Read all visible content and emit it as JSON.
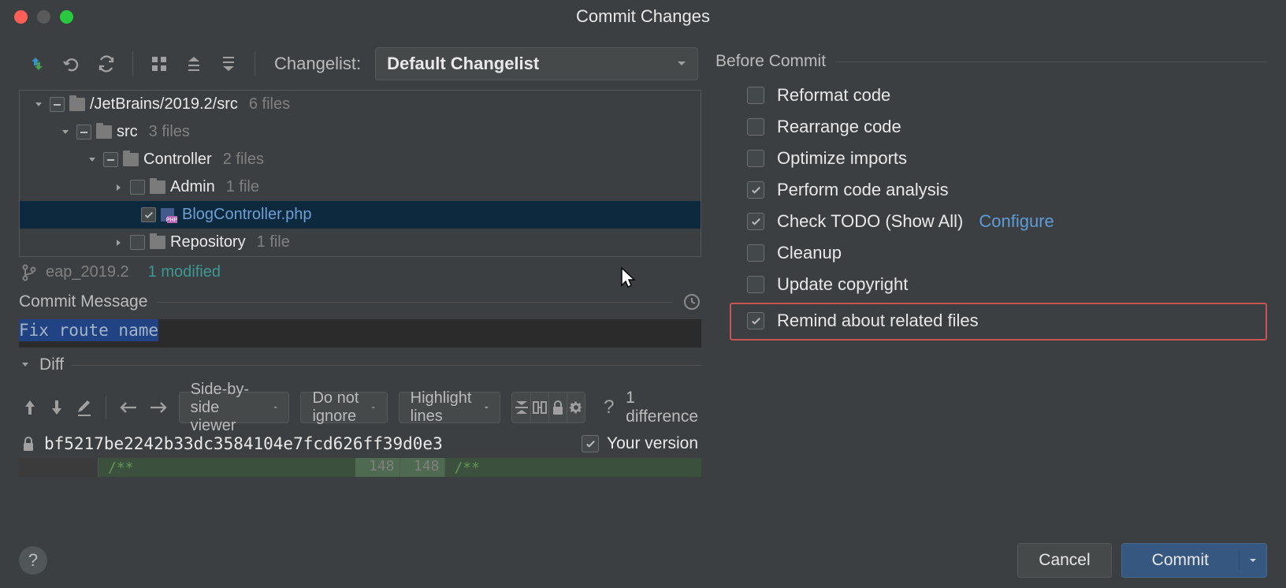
{
  "window_title": "Commit Changes",
  "toolbar": {
    "changelist_label": "Changelist:",
    "changelist_value": "Default Changelist"
  },
  "tree": {
    "root": {
      "label": "/JetBrains/2019.2/src",
      "count": "6 files"
    },
    "src": {
      "label": "src",
      "count": "3 files"
    },
    "controller": {
      "label": "Controller",
      "count": "2 files"
    },
    "admin": {
      "label": "Admin",
      "count": "1 file"
    },
    "blog": {
      "label": "BlogController.php"
    },
    "repo": {
      "label": "Repository",
      "count": "1 file"
    }
  },
  "status": {
    "branch": "eap_2019.2",
    "modified": "1 modified"
  },
  "commit_msg": {
    "label": "Commit Message",
    "value": "Fix route name"
  },
  "diff": {
    "label": "Diff",
    "viewer": "Side-by-side viewer",
    "ignore": "Do not ignore",
    "highlight": "Highlight lines",
    "count": "1 difference",
    "hash": "bf5217be2242b33dc3584104e7fcd626ff39d0e3",
    "your_version": "Your version",
    "left_line": "",
    "right_line_a": "148",
    "right_line_b": "148",
    "comment": "/**"
  },
  "before_commit": {
    "label": "Before Commit",
    "items": {
      "reformat": "Reformat code",
      "rearrange": "Rearrange code",
      "optimize": "Optimize imports",
      "analyze": "Perform code analysis",
      "todo": "Check TODO (Show All)",
      "configure": "Configure",
      "cleanup": "Cleanup",
      "copyright": "Update copyright",
      "remind": "Remind about related files"
    }
  },
  "footer": {
    "cancel": "Cancel",
    "commit": "Commit",
    "help": "?"
  }
}
